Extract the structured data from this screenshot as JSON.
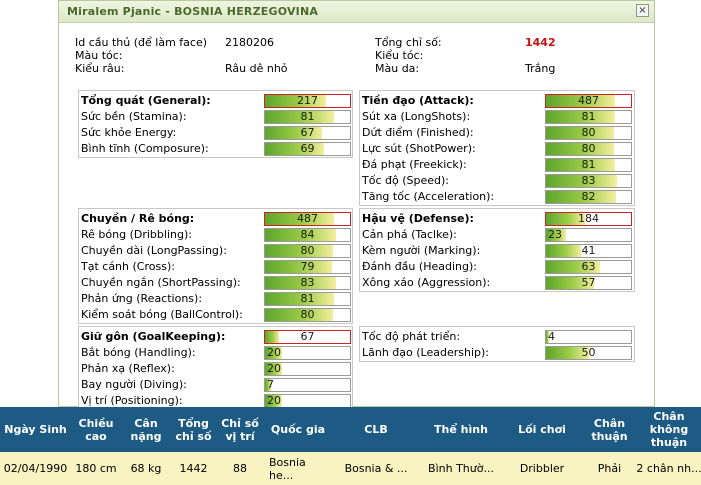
{
  "dialog": {
    "title": "Miralem Pjanic - BOSNIA HERZEGOVINA",
    "close_glyph": "×",
    "info": {
      "id_label": "Id cầu thủ (để làm face)",
      "id_value": "2180206",
      "hair_color_label": "Màu tóc:",
      "beard_label": "Kiểu râu:",
      "beard_value": "Râu dê nhỏ",
      "total_label": "Tổng chỉ số:",
      "total_value": "1442",
      "hair_style_label": "Kiểu tóc:",
      "skin_label": "Màu da:",
      "skin_value": "Trắng"
    },
    "groups": [
      {
        "header": "Tổng quát (General):",
        "header_value": 217,
        "items": [
          {
            "label": "Sức bền (Stamina):",
            "value": 81
          },
          {
            "label": "Sức khỏe Energy:",
            "value": 67
          },
          {
            "label": "Bình tĩnh (Composure):",
            "value": 69
          }
        ]
      },
      {
        "header": "Tiền đạo (Attack):",
        "header_value": 487,
        "items": [
          {
            "label": "Sút xa (LongShots):",
            "value": 81
          },
          {
            "label": "Dứt điểm (Finished):",
            "value": 80
          },
          {
            "label": "Lực sút (ShotPower):",
            "value": 80
          },
          {
            "label": "Đá phạt (Freekick):",
            "value": 81
          },
          {
            "label": "Tốc độ (Speed):",
            "value": 83
          },
          {
            "label": "Tăng tốc (Acceleration):",
            "value": 82
          }
        ]
      },
      {
        "header": "Chuyền / Rê bóng:",
        "header_value": 487,
        "items": [
          {
            "label": "Rê bóng (Dribbling):",
            "value": 84
          },
          {
            "label": "Chuyền dài (LongPassing):",
            "value": 80
          },
          {
            "label": "Tạt cánh (Cross):",
            "value": 79
          },
          {
            "label": "Chuyền ngắn (ShortPassing):",
            "value": 83
          },
          {
            "label": "Phản ứng (Reactions):",
            "value": 81
          },
          {
            "label": "Kiểm soát bóng (BallControl):",
            "value": 80
          }
        ]
      },
      {
        "header": "Hậu vệ (Defense):",
        "header_value": 184,
        "items": [
          {
            "label": "Cản phá (Taclke):",
            "value": 23
          },
          {
            "label": "Kèm người (Marking):",
            "value": 41
          },
          {
            "label": "Đánh đầu (Heading):",
            "value": 63
          },
          {
            "label": "Xông xáo (Aggression):",
            "value": 57
          }
        ]
      },
      {
        "header": "Giữ gôn (GoalKeeping):",
        "header_value": 67,
        "items": [
          {
            "label": "Bắt bóng (Handling):",
            "value": 20
          },
          {
            "label": "Phản xạ (Reflex):",
            "value": 20
          },
          {
            "label": "Bay người (Diving):",
            "value": 7
          },
          {
            "label": "Vị trí (Positioning):",
            "value": 20
          }
        ]
      },
      {
        "items": [
          {
            "label": "Tốc độ phát triển:",
            "value": 4
          },
          {
            "label": "Lãnh đạo (Leadership):",
            "value": 50
          }
        ]
      }
    ]
  },
  "table": {
    "headers": [
      "Ngày Sinh",
      "Chiều cao",
      "Cân nặng",
      "Tổng chỉ số",
      "Chỉ số vị trí",
      "Quốc gia",
      "CLB",
      "Thể hình",
      "Lối chơi",
      "Chân thuận",
      "Chân không thuận"
    ],
    "row": [
      "02/04/1990",
      "180 cm",
      "68 kg",
      "1442",
      "88",
      "Bosnia he...",
      "Bosnia & ...",
      "Bình Thườ...",
      "Dribbler",
      "Phải",
      "2 chân nh..."
    ]
  },
  "colors": {
    "accent_header_bg": "#1d5b84",
    "row_bg": "#f8f3c0",
    "bar_fill": "#7db83a",
    "header_bar_border": "#cc2222",
    "total_value": "#cc1111"
  }
}
